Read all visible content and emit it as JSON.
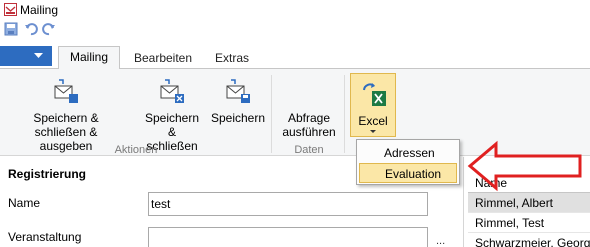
{
  "window": {
    "title": "Mailing",
    "app_icon": "mailing-app-icon"
  },
  "quick_access": {
    "items": [
      "save-icon",
      "undo-icon",
      "redo-icon"
    ]
  },
  "tabs": [
    {
      "label": "Mailing",
      "active": true
    },
    {
      "label": "Bearbeiten",
      "active": false
    },
    {
      "label": "Extras",
      "active": false
    }
  ],
  "ribbon": {
    "buttons": {
      "save_close_output": "Speichern & schließen & ausgeben",
      "save_close": "Speichern & schließen",
      "save": "Speichern",
      "run_query": "Abfrage ausführen",
      "excel": "Excel"
    },
    "groups": {
      "actions": "Aktionen",
      "data": "Daten"
    }
  },
  "excel_menu": {
    "items": [
      {
        "label": "Adressen",
        "highlighted": false
      },
      {
        "label": "Evaluation",
        "highlighted": true
      }
    ]
  },
  "form": {
    "section_title": "Registrierung",
    "name_label": "Name",
    "name_value": "test",
    "event_label": "Veranstaltung",
    "event_value": "",
    "ellipsis": "..."
  },
  "grid": {
    "header": "Name",
    "rows": [
      "Rimmel, Albert",
      "Rimmel, Test",
      "Schwarzmeier, Georg"
    ]
  },
  "colors": {
    "accent": "#2d6cc0",
    "highlight": "#fbe7a7",
    "arrow": "#e02020"
  }
}
